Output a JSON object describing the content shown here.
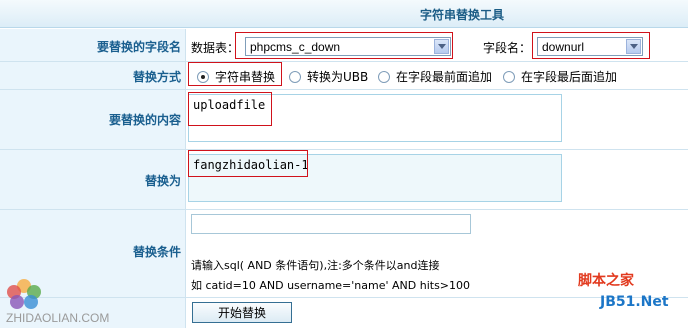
{
  "title": "字符串替换工具",
  "field_row": {
    "label": "要替换的字段名",
    "table_label": "数据表：",
    "table_value": "phpcms_c_down",
    "field_label": "字段名：",
    "field_value": "downurl"
  },
  "mode_row": {
    "label": "替换方式",
    "options": [
      {
        "label": "字符串替换",
        "checked": true
      },
      {
        "label": "转换为UBB",
        "checked": false
      },
      {
        "label": "在字段最前面追加",
        "checked": false
      },
      {
        "label": "在字段最后面追加",
        "checked": false
      }
    ]
  },
  "content_row": {
    "label": "要替换的内容",
    "value": "uploadfile"
  },
  "replace_row": {
    "label": "替换为",
    "value": "fangzhidaolian-1"
  },
  "condition_row": {
    "label": "替换条件",
    "value": "",
    "hint_line1": "请输入sql( AND 条件语句),注:多个条件以and连接",
    "hint_line2": "如 catid=10 AND username='name' AND hits>100"
  },
  "submit_label": "开始替换",
  "watermarks": {
    "left_text": "ZHIDAOLIAN.COM",
    "right_cn": "脚本之家",
    "right_en": "JB51.Net"
  },
  "colors": {
    "label_text": "#1a5f8f",
    "label_bg": "#eaf5fc",
    "highlight_box": "#d0121b"
  }
}
